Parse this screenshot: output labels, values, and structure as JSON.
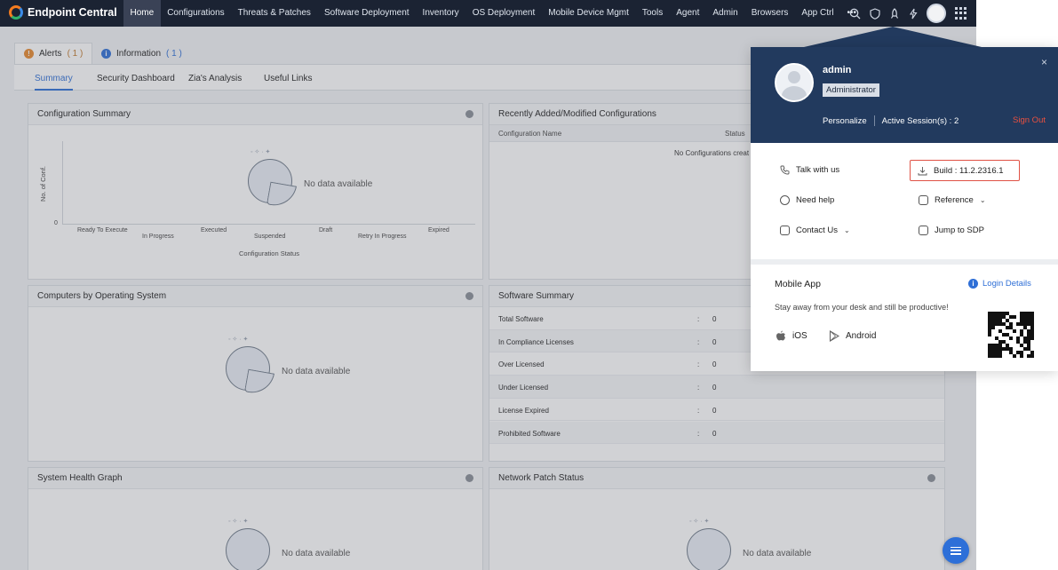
{
  "app": {
    "brand": "Endpoint Central",
    "nav": [
      "Home",
      "Configurations",
      "Threats & Patches",
      "Software Deployment",
      "Inventory",
      "OS Deployment",
      "Mobile Device Mgmt",
      "Tools",
      "Agent",
      "Admin",
      "Browsers",
      "App Ctrl",
      "•••"
    ],
    "active_nav": "Home",
    "nav_icons": [
      "search-icon",
      "shield-icon",
      "rocket-icon",
      "bolt-icon",
      "avatar",
      "apps-grid-icon"
    ]
  },
  "alerts_bar": {
    "alerts_label": "Alerts",
    "alerts_count": "( 1 )",
    "info_label": "Information",
    "info_count": "( 1 )"
  },
  "subtabs": [
    "Summary",
    "Security Dashboard",
    "Zia's Analysis",
    "Useful Links"
  ],
  "panels": {
    "config_summary": {
      "title": "Configuration Summary",
      "no_data": "No data available",
      "y_label": "No. of Conf.",
      "y_zero": "0",
      "x_title": "Configuration Status",
      "x_ticks": [
        "Ready To Execute",
        "In Progress",
        "Executed",
        "Suspended",
        "Draft",
        "Retry In Progress",
        "Expired"
      ]
    },
    "recent_configs": {
      "title": "Recently Added/Modified Configurations",
      "col_name": "Configuration Name",
      "col_status": "Status",
      "empty": "No Configurations creat"
    },
    "computers_os": {
      "title": "Computers by Operating System",
      "no_data": "No data available"
    },
    "software_summary": {
      "title": "Software Summary",
      "rows": [
        {
          "label": "Total Software",
          "value": "0"
        },
        {
          "label": "In Compliance Licenses",
          "value": "0"
        },
        {
          "label": "Over Licensed",
          "value": "0"
        },
        {
          "label": "Under Licensed",
          "value": "0"
        },
        {
          "label": "License Expired",
          "value": "0"
        },
        {
          "label": "Prohibited Software",
          "value": "0"
        }
      ]
    },
    "system_health": {
      "title": "System Health Graph",
      "no_data": "No data available"
    },
    "network_patch": {
      "title": "Network Patch Status",
      "no_data": "No data available"
    }
  },
  "profile_popup": {
    "name": "admin",
    "role": "Administrator",
    "personalize": "Personalize",
    "sessions_label": "Active Session(s) :",
    "sessions_count": "2",
    "sign_out": "Sign Out",
    "close": "×",
    "talk": "Talk with us",
    "build": "Build : 11.2.2316.1",
    "need_help": "Need help",
    "reference": "Reference",
    "contact": "Contact Us",
    "jump_sdp": "Jump to SDP",
    "mobile_title": "Mobile App",
    "login_details": "Login Details",
    "tagline": "Stay away from your desk and still be productive!",
    "ios": "iOS",
    "android": "Android"
  }
}
